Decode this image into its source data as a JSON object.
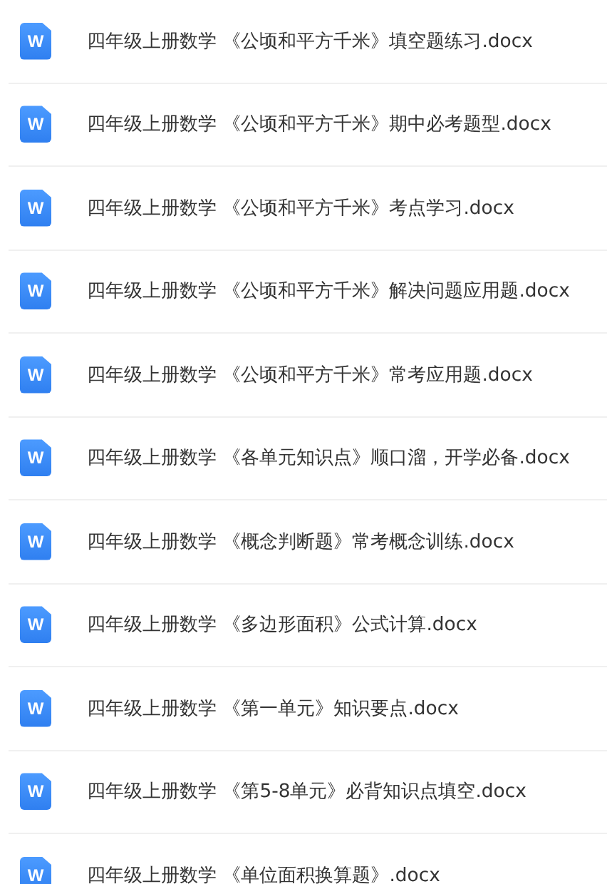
{
  "files": [
    {
      "name": "四年级上册数学 《公顷和平方千米》填空题练习.docx",
      "icon_label": "W"
    },
    {
      "name": "四年级上册数学 《公顷和平方千米》期中必考题型.docx",
      "icon_label": "W"
    },
    {
      "name": "四年级上册数学 《公顷和平方千米》考点学习.docx",
      "icon_label": "W"
    },
    {
      "name": "四年级上册数学 《公顷和平方千米》解决问题应用题.docx",
      "icon_label": "W"
    },
    {
      "name": "四年级上册数学 《公顷和平方千米》常考应用题.docx",
      "icon_label": "W"
    },
    {
      "name": "四年级上册数学 《各单元知识点》顺口溜，开学必备.docx",
      "icon_label": "W"
    },
    {
      "name": "四年级上册数学 《概念判断题》常考概念训练.docx",
      "icon_label": "W"
    },
    {
      "name": "四年级上册数学 《多边形面积》公式计算.docx",
      "icon_label": "W"
    },
    {
      "name": "四年级上册数学 《第一单元》知识要点.docx",
      "icon_label": "W"
    },
    {
      "name": "四年级上册数学 《第5-8单元》必背知识点填空.docx",
      "icon_label": "W"
    },
    {
      "name": "四年级上册数学 《单位面积换算题》.docx",
      "icon_label": "W"
    }
  ]
}
